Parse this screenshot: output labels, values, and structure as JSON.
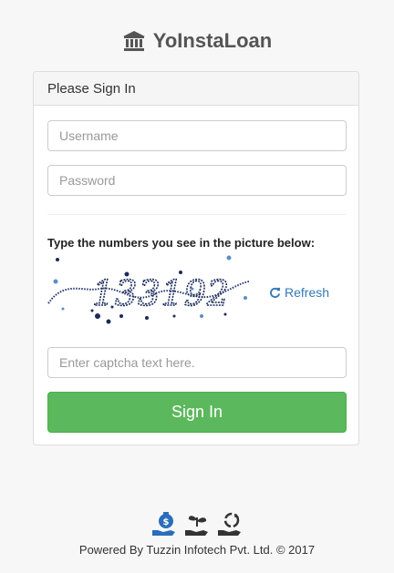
{
  "brand": {
    "name": "YoInstaLoan",
    "icon": "bank-icon"
  },
  "panel": {
    "heading": "Please Sign In"
  },
  "form": {
    "username_placeholder": "Username",
    "username_value": "",
    "password_placeholder": "Password",
    "password_value": "",
    "captcha_label": "Type the numbers you see in the picture below:",
    "captcha_text": "133192",
    "refresh_label": "Refresh",
    "captcha_placeholder": "Enter captcha text here.",
    "captcha_value": "",
    "signin_label": "Sign In"
  },
  "footer": {
    "icons": [
      "money-bag-hand-icon",
      "plant-hand-icon",
      "recycle-hand-icon"
    ],
    "text": "Powered By Tuzzin Infotech Pvt. Ltd. © 2017"
  },
  "colors": {
    "primary_button": "#5cb85c",
    "link": "#337ab7",
    "brand_text": "#555555",
    "footer_icon": "#2a6ebb"
  }
}
